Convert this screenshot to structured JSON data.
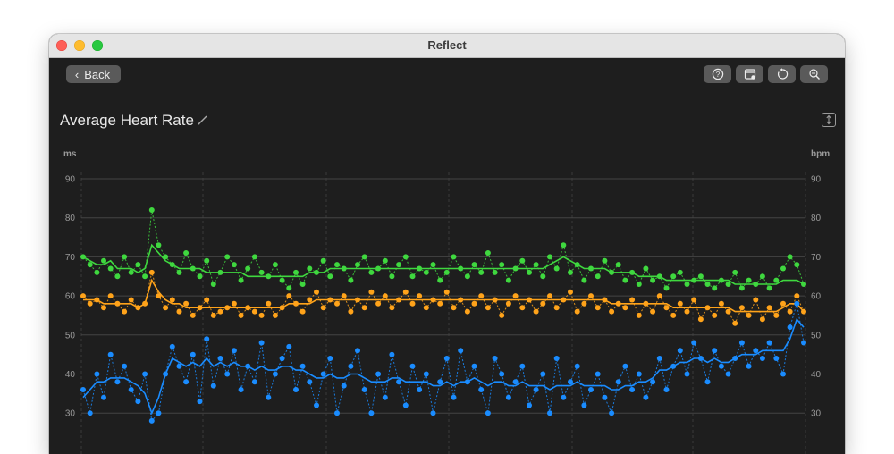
{
  "window": {
    "title": "Reflect"
  },
  "toolbar": {
    "back_label": "Back",
    "buttons": [
      {
        "name": "help-button",
        "icon": "question-circle-icon"
      },
      {
        "name": "calendar-button",
        "icon": "calendar-icon"
      },
      {
        "name": "reset-button",
        "icon": "reset-icon"
      },
      {
        "name": "zoom-button",
        "icon": "zoom-icon"
      }
    ]
  },
  "page": {
    "title": "Average Heart Rate"
  },
  "axis": {
    "left_unit": "ms",
    "right_unit": "bpm"
  },
  "colors": {
    "green": "#3fd83f",
    "orange": "#ffa31a",
    "blue": "#1a8cff",
    "grid": "#444444",
    "tick": "#9a9a9a"
  },
  "chart_data": {
    "type": "line",
    "ylim": [
      25,
      90
    ],
    "yticks": [
      90,
      80,
      70,
      60,
      50,
      40,
      30
    ],
    "series": [
      {
        "color": "green",
        "axis": "right",
        "values": [
          70,
          68,
          66,
          69,
          67,
          65,
          70,
          66,
          68,
          65,
          82,
          73,
          70,
          68,
          66,
          71,
          67,
          65,
          69,
          63,
          66,
          70,
          68,
          64,
          67,
          70,
          66,
          65,
          68,
          64,
          62,
          66,
          63,
          67,
          66,
          69,
          65,
          68,
          67,
          64,
          68,
          70,
          66,
          67,
          69,
          65,
          68,
          70,
          65,
          67,
          66,
          68,
          64,
          66,
          70,
          67,
          65,
          68,
          66,
          71,
          66,
          68,
          64,
          67,
          69,
          66,
          68,
          65,
          70,
          67,
          73,
          66,
          68,
          64,
          67,
          65,
          69,
          66,
          68,
          64,
          66,
          63,
          67,
          64,
          65,
          62,
          65,
          66,
          63,
          64,
          65,
          63,
          62,
          64,
          63,
          66,
          62,
          64,
          63,
          65,
          62,
          64,
          67,
          70,
          68,
          63
        ],
        "trend": [
          70,
          69,
          68,
          68,
          69,
          67,
          67,
          67,
          66,
          67,
          73,
          71,
          69,
          68,
          67,
          67,
          67,
          67,
          66,
          66,
          66,
          66,
          66,
          66,
          65,
          65,
          65,
          65,
          65,
          65,
          65,
          65,
          65,
          66,
          66,
          66,
          67,
          67,
          67,
          67,
          67,
          67,
          67,
          67,
          67,
          67,
          67,
          67,
          67,
          67,
          67,
          67,
          67,
          67,
          67,
          67,
          67,
          67,
          67,
          67,
          67,
          67,
          67,
          67,
          67,
          67,
          67,
          67,
          68,
          69,
          70,
          69,
          68,
          67,
          67,
          67,
          67,
          66,
          66,
          66,
          66,
          65,
          65,
          65,
          65,
          64,
          64,
          64,
          64,
          64,
          64,
          64,
          64,
          64,
          64,
          63,
          63,
          63,
          63,
          63,
          63,
          63,
          64,
          64,
          64,
          63
        ]
      },
      {
        "color": "orange",
        "axis": "right",
        "values": [
          60,
          58,
          59,
          57,
          60,
          58,
          56,
          59,
          57,
          58,
          66,
          60,
          57,
          59,
          56,
          58,
          55,
          57,
          59,
          55,
          56,
          57,
          58,
          55,
          57,
          56,
          55,
          58,
          55,
          57,
          60,
          58,
          56,
          59,
          61,
          57,
          59,
          58,
          60,
          56,
          59,
          57,
          61,
          58,
          60,
          57,
          59,
          61,
          58,
          60,
          57,
          59,
          58,
          61,
          57,
          59,
          56,
          58,
          60,
          57,
          59,
          55,
          58,
          60,
          57,
          59,
          56,
          58,
          60,
          57,
          59,
          61,
          56,
          58,
          60,
          57,
          59,
          56,
          58,
          57,
          59,
          55,
          58,
          56,
          60,
          57,
          55,
          58,
          56,
          59,
          54,
          57,
          55,
          58,
          56,
          53,
          57,
          55,
          59,
          54,
          57,
          55,
          58,
          56,
          60,
          56
        ],
        "trend": [
          59,
          59,
          59,
          58,
          58,
          58,
          58,
          58,
          57,
          58,
          64,
          61,
          59,
          58,
          58,
          57,
          57,
          57,
          57,
          57,
          57,
          57,
          57,
          57,
          57,
          57,
          57,
          57,
          57,
          57,
          58,
          58,
          58,
          58,
          59,
          59,
          59,
          59,
          59,
          59,
          59,
          59,
          59,
          59,
          59,
          59,
          59,
          59,
          59,
          59,
          59,
          59,
          59,
          59,
          59,
          59,
          59,
          59,
          59,
          59,
          59,
          59,
          59,
          59,
          59,
          59,
          59,
          59,
          59,
          59,
          59,
          59,
          59,
          59,
          59,
          59,
          59,
          58,
          58,
          58,
          58,
          58,
          58,
          58,
          58,
          58,
          57,
          57,
          57,
          57,
          57,
          57,
          57,
          57,
          57,
          56,
          56,
          56,
          56,
          56,
          56,
          56,
          57,
          58,
          58,
          56
        ]
      },
      {
        "color": "blue",
        "axis": "left",
        "values": [
          36,
          30,
          40,
          34,
          45,
          38,
          42,
          36,
          33,
          40,
          28,
          30,
          40,
          47,
          42,
          38,
          45,
          33,
          49,
          37,
          44,
          40,
          46,
          36,
          42,
          38,
          48,
          34,
          40,
          44,
          47,
          36,
          42,
          38,
          32,
          40,
          44,
          30,
          37,
          42,
          46,
          36,
          30,
          40,
          34,
          45,
          38,
          32,
          42,
          36,
          40,
          30,
          38,
          44,
          34,
          46,
          38,
          42,
          36,
          30,
          44,
          40,
          34,
          38,
          42,
          32,
          36,
          40,
          30,
          44,
          34,
          38,
          42,
          32,
          36,
          40,
          34,
          30,
          38,
          42,
          36,
          40,
          34,
          38,
          44,
          36,
          42,
          46,
          40,
          48,
          44,
          38,
          46,
          42,
          40,
          44,
          48,
          42,
          46,
          44,
          48,
          44,
          40,
          52,
          58,
          48
        ],
        "trend": [
          34,
          36,
          38,
          38,
          39,
          39,
          39,
          38,
          37,
          35,
          30,
          34,
          40,
          44,
          43,
          42,
          43,
          42,
          44,
          42,
          43,
          42,
          43,
          42,
          42,
          41,
          42,
          41,
          41,
          42,
          42,
          41,
          41,
          40,
          39,
          39,
          40,
          39,
          39,
          40,
          40,
          39,
          38,
          38,
          38,
          39,
          39,
          38,
          38,
          38,
          38,
          37,
          37,
          38,
          37,
          38,
          38,
          39,
          38,
          37,
          38,
          38,
          37,
          37,
          38,
          37,
          37,
          37,
          36,
          37,
          37,
          37,
          38,
          37,
          37,
          37,
          37,
          36,
          36,
          37,
          37,
          38,
          38,
          39,
          41,
          41,
          42,
          43,
          43,
          44,
          44,
          43,
          44,
          43,
          43,
          44,
          45,
          45,
          45,
          46,
          46,
          46,
          46,
          49,
          54,
          52
        ]
      }
    ]
  }
}
